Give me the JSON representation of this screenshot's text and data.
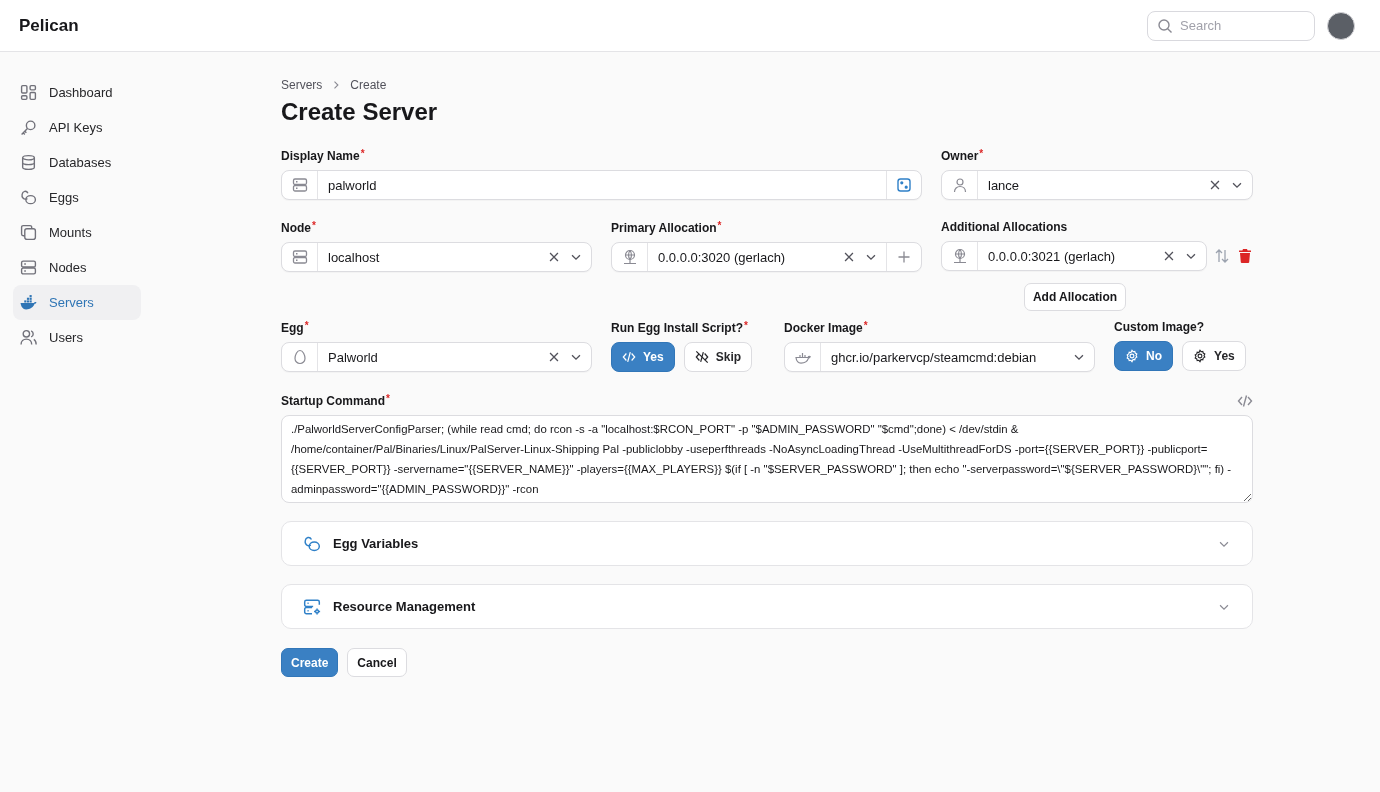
{
  "app": {
    "name": "Pelican"
  },
  "search": {
    "placeholder": "Search"
  },
  "sidebar": {
    "items": [
      {
        "label": "Dashboard",
        "selected": false
      },
      {
        "label": "API Keys",
        "selected": false
      },
      {
        "label": "Databases",
        "selected": false
      },
      {
        "label": "Eggs",
        "selected": false
      },
      {
        "label": "Mounts",
        "selected": false
      },
      {
        "label": "Nodes",
        "selected": false
      },
      {
        "label": "Servers",
        "selected": true
      },
      {
        "label": "Users",
        "selected": false
      }
    ]
  },
  "breadcrumbs": [
    "Servers",
    "Create"
  ],
  "page_title": "Create Server",
  "display_name": {
    "label": "Display Name",
    "required_mark": "*",
    "value": "palworld"
  },
  "owner": {
    "label": "Owner",
    "required_mark": "*",
    "value": "lance"
  },
  "node": {
    "label": "Node",
    "required_mark": "*",
    "value": "localhost"
  },
  "primary_allocation": {
    "label": "Primary Allocation",
    "required_mark": "*",
    "value": "0.0.0.0:3020 (gerlach)"
  },
  "additional_allocations": {
    "label": "Additional Allocations",
    "value": "0.0.0.0:3021 (gerlach)",
    "add_button": "Add Allocation"
  },
  "egg": {
    "label": "Egg",
    "required_mark": "*",
    "value": "Palworld"
  },
  "run_install_script": {
    "label": "Run Egg Install Script?",
    "required_mark": "*",
    "options": [
      {
        "label": "Yes",
        "selected": true
      },
      {
        "label": "Skip",
        "selected": false
      }
    ]
  },
  "docker_image": {
    "label": "Docker Image",
    "required_mark": "*",
    "value": "ghcr.io/parkervcp/steamcmd:debian"
  },
  "custom_image": {
    "label": "Custom Image?",
    "options": [
      {
        "label": "No",
        "selected": true
      },
      {
        "label": "Yes",
        "selected": false
      }
    ]
  },
  "startup_command": {
    "label": "Startup Command",
    "required_mark": "*",
    "value": "./PalworldServerConfigParser; (while read cmd; do rcon -s -a \"localhost:$RCON_PORT\" -p \"$ADMIN_PASSWORD\" \"$cmd\";done) < /dev/stdin & /home/container/Pal/Binaries/Linux/PalServer-Linux-Shipping Pal -publiclobby -useperfthreads -NoAsyncLoadingThread -UseMultithreadForDS -port={{SERVER_PORT}} -publicport={{SERVER_PORT}} -servername=\"{{SERVER_NAME}}\" -players={{MAX_PLAYERS}} $(if [ -n \"$SERVER_PASSWORD\" ]; then echo \"-serverpassword=\\\"${SERVER_PASSWORD}\\\"\"; fi) -adminpassword=\"{{ADMIN_PASSWORD}}\" -rcon"
  },
  "sections": [
    {
      "title": "Egg Variables",
      "expanded": false
    },
    {
      "title": "Resource Management",
      "expanded": false
    }
  ],
  "actions": [
    {
      "label": "Create",
      "kind": "primary"
    },
    {
      "label": "Cancel",
      "kind": "secondary"
    }
  ]
}
